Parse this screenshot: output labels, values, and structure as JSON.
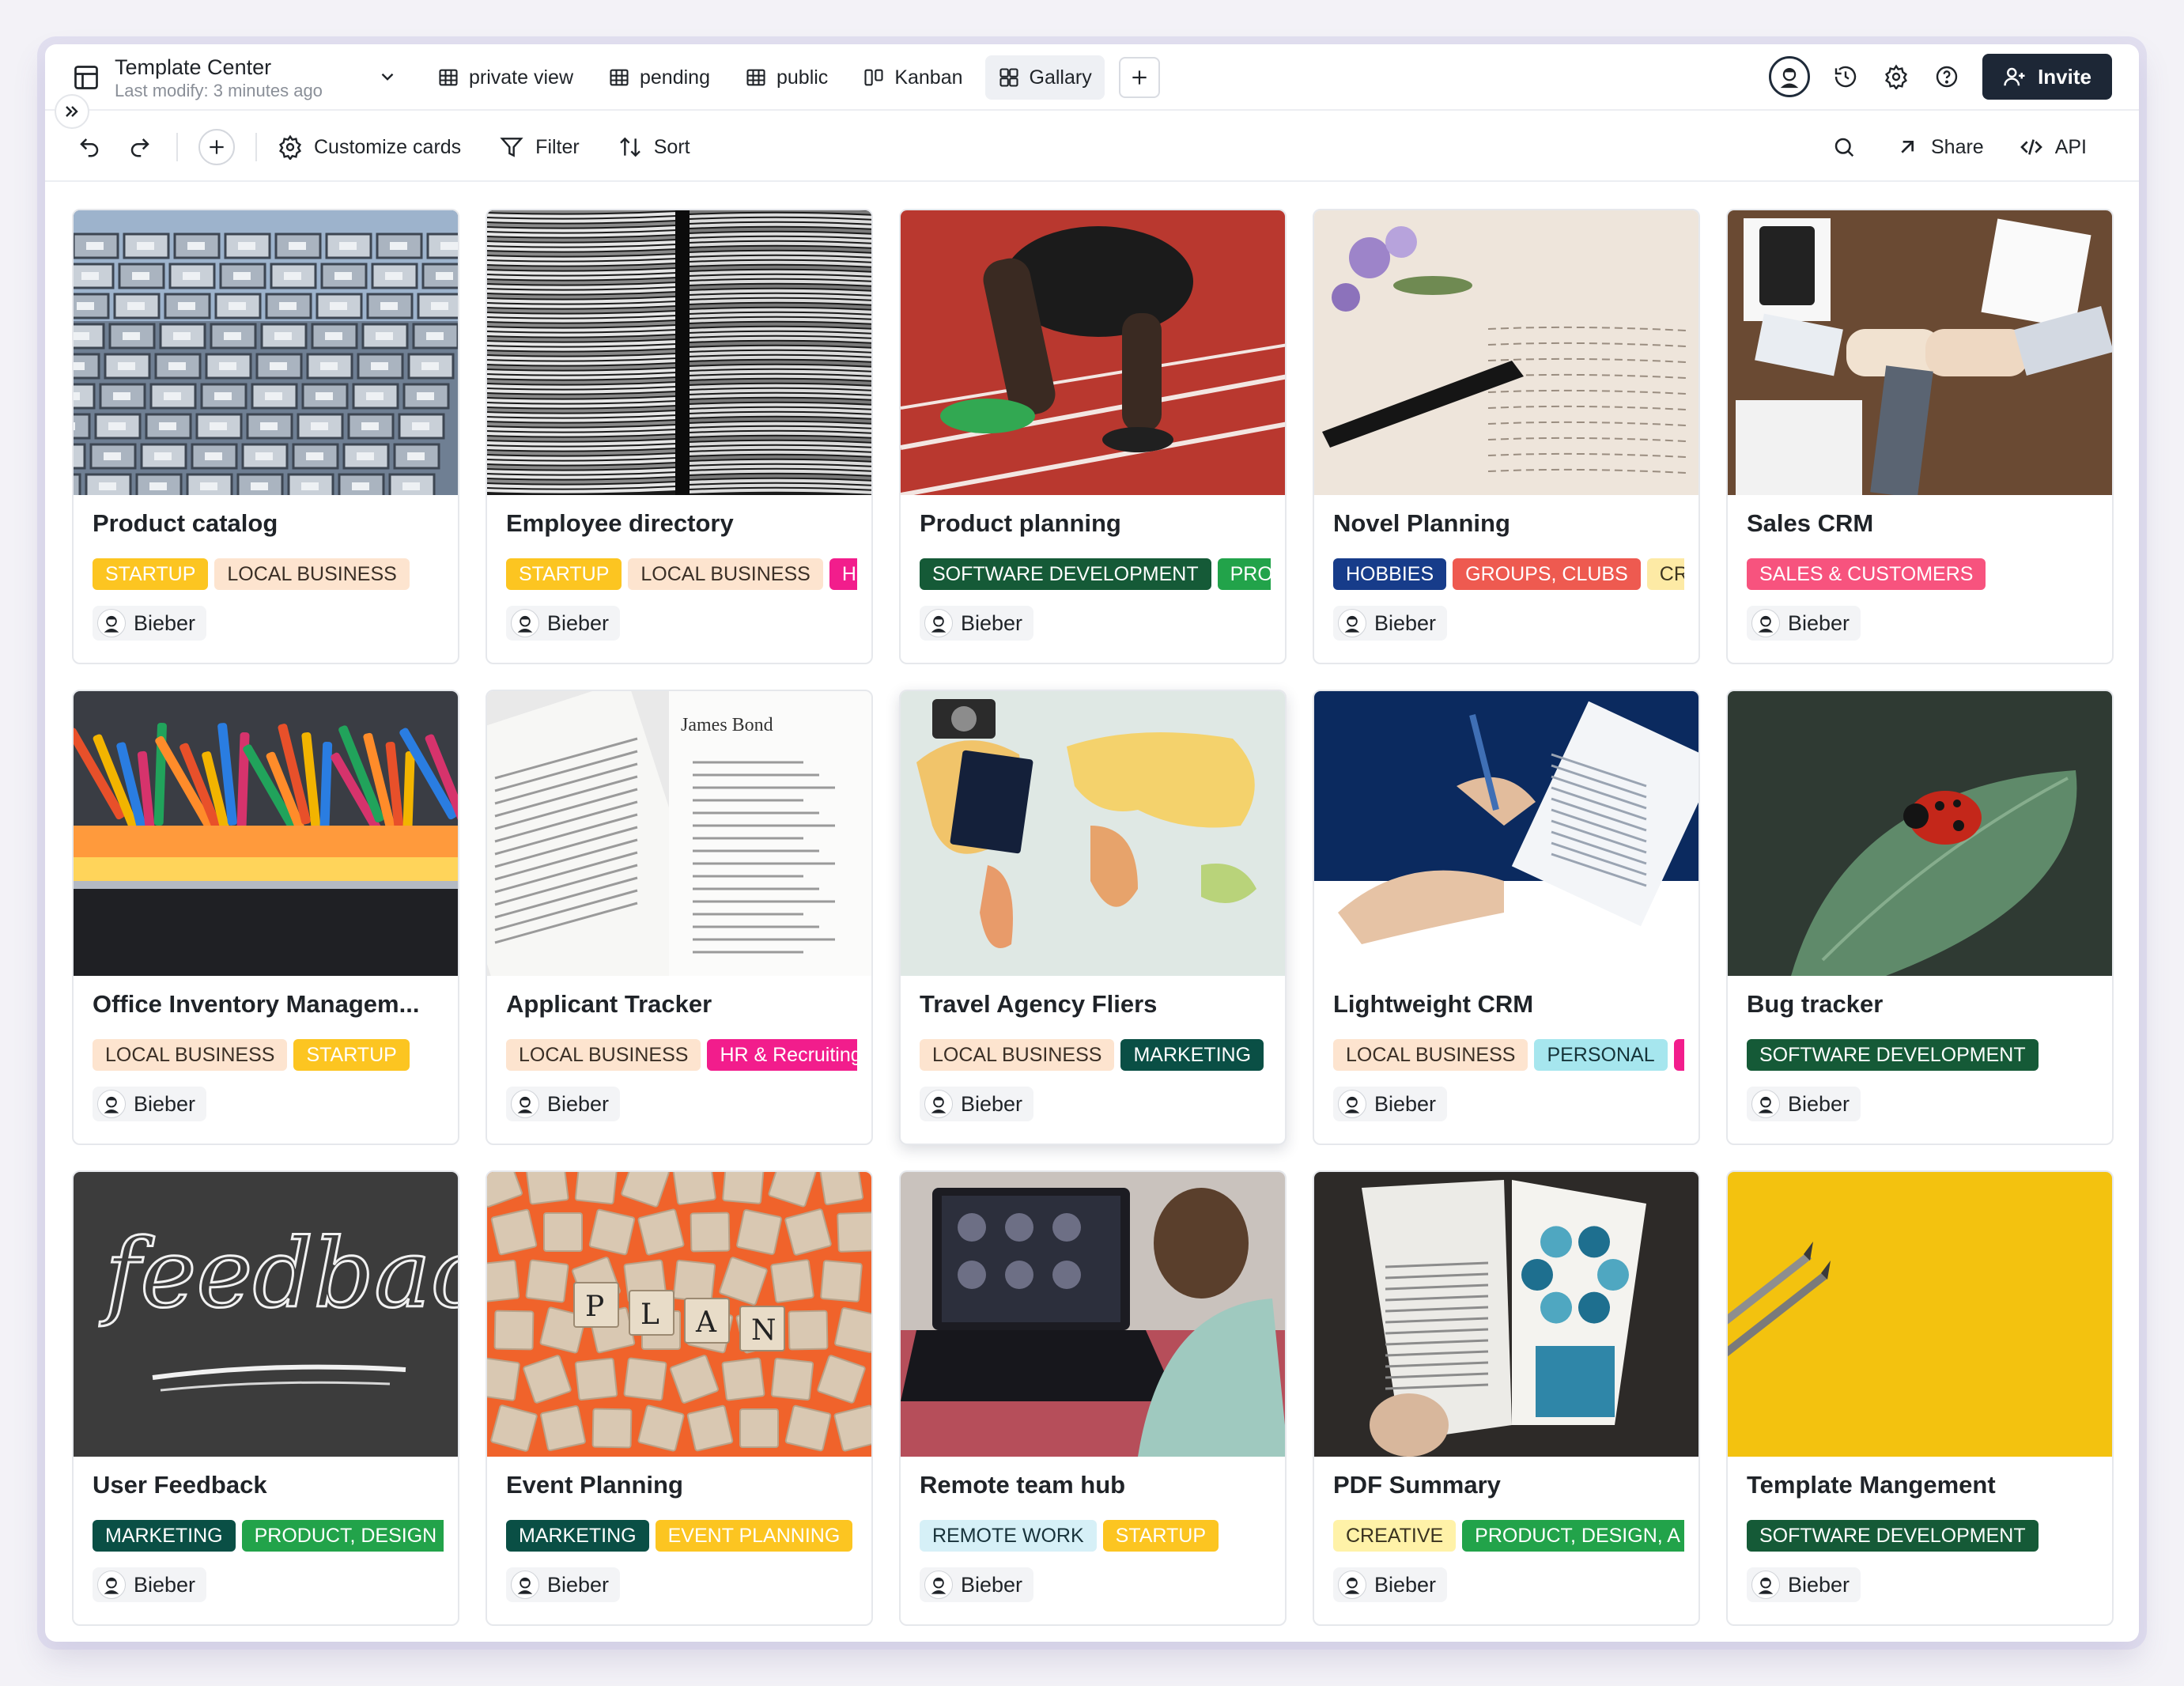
{
  "header": {
    "title": "Template Center",
    "subtitle": "Last modify: 3 minutes ago",
    "views": [
      {
        "label": "private view",
        "icon": "grid-icon"
      },
      {
        "label": "pending",
        "icon": "grid-icon"
      },
      {
        "label": "public",
        "icon": "grid-icon"
      },
      {
        "label": "Kanban",
        "icon": "kanban-icon"
      },
      {
        "label": "Gallary",
        "icon": "gallery-icon",
        "active": true
      }
    ],
    "invite_label": "Invite"
  },
  "toolbar": {
    "customize_label": "Customize cards",
    "filter_label": "Filter",
    "sort_label": "Sort",
    "share_label": "Share",
    "api_label": "API"
  },
  "cards": [
    {
      "title": "Product catalog",
      "tags": [
        {
          "label": "STARTUP",
          "color": "yellow"
        },
        {
          "label": "LOCAL BUSINESS",
          "color": "peach"
        }
      ],
      "owner": "Bieber",
      "image": "warehouse-shelves"
    },
    {
      "title": "Employee directory",
      "tags": [
        {
          "label": "STARTUP",
          "color": "yellow"
        },
        {
          "label": "LOCAL BUSINESS",
          "color": "peach"
        },
        {
          "label": "H",
          "color": "pink"
        }
      ],
      "owner": "Bieber",
      "image": "paper-stacks"
    },
    {
      "title": "Product planning",
      "tags": [
        {
          "label": "SOFTWARE DEVELOPMENT",
          "color": "darkgreen"
        },
        {
          "label": "PRO",
          "color": "green"
        }
      ],
      "owner": "Bieber",
      "image": "running-track"
    },
    {
      "title": "Novel Planning",
      "tags": [
        {
          "label": "HOBBIES",
          "color": "navy"
        },
        {
          "label": "GROUPS, CLUBS",
          "color": "coral"
        },
        {
          "label": "CR",
          "color": "cream"
        }
      ],
      "owner": "Bieber",
      "image": "fountain-pen"
    },
    {
      "title": "Sales CRM",
      "tags": [
        {
          "label": "SALES & CUSTOMERS",
          "color": "rose"
        }
      ],
      "owner": "Bieber",
      "image": "team-fists"
    },
    {
      "title": "Office Inventory Managem...",
      "tags": [
        {
          "label": "LOCAL BUSINESS",
          "color": "peach"
        },
        {
          "label": "STARTUP",
          "color": "yellow"
        }
      ],
      "owner": "Bieber",
      "image": "stationery-box"
    },
    {
      "title": "Applicant Tracker",
      "tags": [
        {
          "label": "LOCAL BUSINESS",
          "color": "peach"
        },
        {
          "label": "HR & Recruiting",
          "color": "pink"
        }
      ],
      "owner": "Bieber",
      "image": "resumes"
    },
    {
      "title": "Travel Agency Fliers",
      "tags": [
        {
          "label": "LOCAL BUSINESS",
          "color": "peach"
        },
        {
          "label": "MARKETING",
          "color": "teal"
        }
      ],
      "owner": "Bieber",
      "image": "world-map",
      "hover": true
    },
    {
      "title": "Lightweight CRM",
      "tags": [
        {
          "label": "LOCAL BUSINESS",
          "color": "peach"
        },
        {
          "label": "PERSONAL",
          "color": "aqua"
        },
        {
          "label": "S",
          "color": "pink"
        }
      ],
      "owner": "Bieber",
      "image": "handshake-docs"
    },
    {
      "title": "Bug tracker",
      "tags": [
        {
          "label": "SOFTWARE DEVELOPMENT",
          "color": "darkgreen"
        }
      ],
      "owner": "Bieber",
      "image": "ladybug"
    },
    {
      "title": "User Feedback",
      "tags": [
        {
          "label": "MARKETING",
          "color": "teal"
        },
        {
          "label": "PRODUCT, DESIGN",
          "color": "green"
        }
      ],
      "owner": "Bieber",
      "image": "chalkboard"
    },
    {
      "title": "Event Planning",
      "tags": [
        {
          "label": "MARKETING",
          "color": "teal"
        },
        {
          "label": "EVENT PLANNING",
          "color": "yellow"
        }
      ],
      "owner": "Bieber",
      "image": "plan-tiles"
    },
    {
      "title": "Remote team hub",
      "tags": [
        {
          "label": "REMOTE WORK",
          "color": "lightblue"
        },
        {
          "label": "STARTUP",
          "color": "yellow"
        }
      ],
      "owner": "Bieber",
      "image": "laptop-call"
    },
    {
      "title": "PDF Summary",
      "tags": [
        {
          "label": "CREATIVE",
          "color": "paleyellow"
        },
        {
          "label": "PRODUCT, DESIGN, A",
          "color": "green"
        }
      ],
      "owner": "Bieber",
      "image": "magazine"
    },
    {
      "title": "Template Mangement",
      "tags": [
        {
          "label": "SOFTWARE DEVELOPMENT",
          "color": "darkgreen"
        }
      ],
      "owner": "Bieber",
      "image": "yellow-pencils"
    }
  ]
}
